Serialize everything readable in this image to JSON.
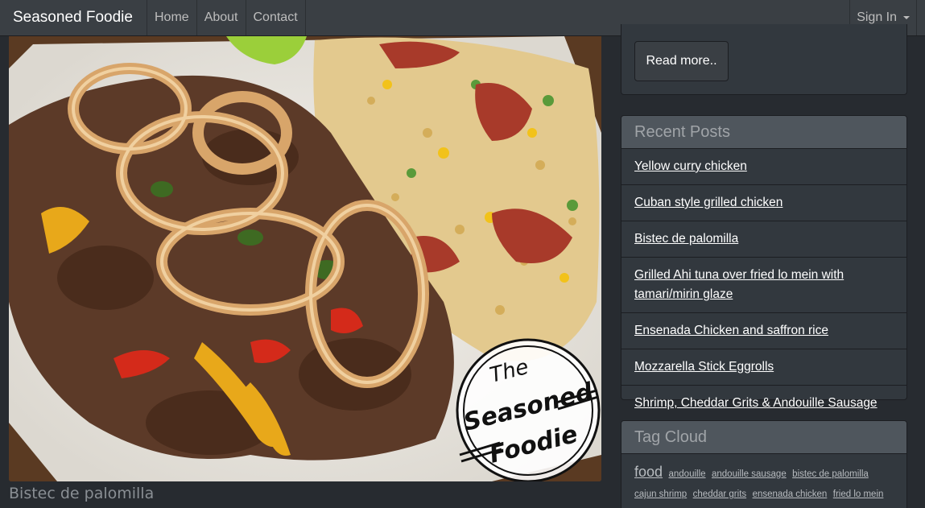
{
  "navbar": {
    "brand": "Seasoned Foodie",
    "links": [
      "Home",
      "About",
      "Contact"
    ],
    "signin": "Sign In"
  },
  "post": {
    "caption": "Bistec de palomilla",
    "watermark": [
      "The",
      "Seasoned",
      "Foodie"
    ]
  },
  "sidebar": {
    "read_more": "Read more..",
    "recent_title": "Recent Posts",
    "recent_posts": [
      "Yellow curry chicken",
      "Cuban style grilled chicken",
      "Bistec de palomilla",
      "Grilled Ahi tuna over fried lo mein with tamari/mirin glaze",
      "Ensenada Chicken and saffron rice",
      "Mozzarella Stick Eggrolls",
      "Shrimp, Cheddar Grits & Andouille Sausage"
    ],
    "tag_title": "Tag Cloud",
    "tags": [
      "food",
      "andouille",
      "andouille sausage",
      "bistec de palomilla",
      "cajun shrimp",
      "cheddar grits",
      "ensenada chicken",
      "fried lo mein"
    ]
  },
  "colors": {
    "background": "#272b30",
    "navbar": "#3a3f44",
    "panel": "#32383e",
    "panel_heading": "#4f565d"
  }
}
